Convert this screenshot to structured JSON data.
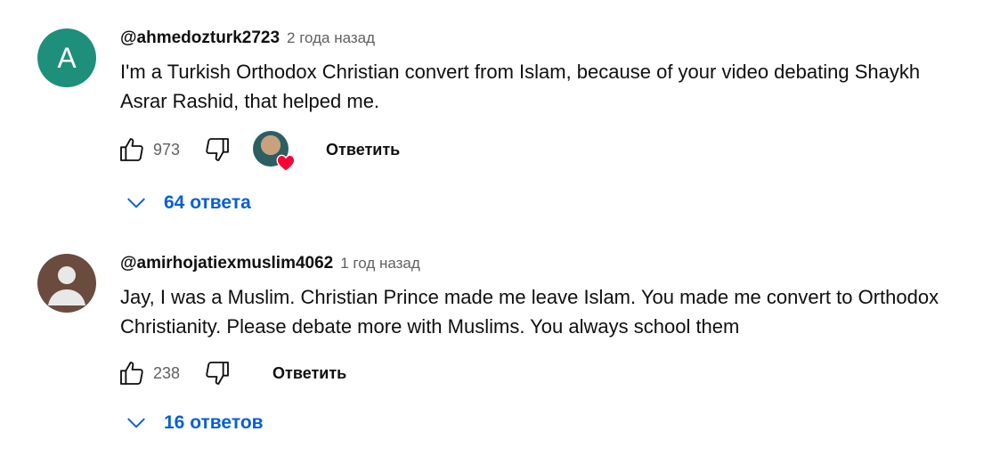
{
  "comments": [
    {
      "avatar_letter": "A",
      "author": "@ahmedozturk2723",
      "time": "2 года назад",
      "text_line1": "I'm a Turkish Orthodox Christian convert from Islam, because of your video debating Shaykh",
      "text_line2": "Asrar Rashid, that helped me.",
      "likes": "973",
      "reply_label": "Ответить",
      "replies_label": "64 ответа",
      "creator_heart": true
    },
    {
      "avatar_letter": "",
      "author": "@amirhojatiexmuslim4062",
      "time": "1 год назад",
      "text_line1": "Jay, I was a Muslim. Christian Prince made me leave Islam. You made me convert to Orthodox",
      "text_line2": "Christianity. Please debate more with Muslims. You always school them",
      "likes": "238",
      "reply_label": "Ответить",
      "replies_label": "16 ответов",
      "creator_heart": false
    }
  ],
  "icons": {
    "like": "thumb-up-icon",
    "dislike": "thumb-down-icon",
    "expand": "chevron-down-icon",
    "heart": "heart-icon"
  },
  "colors": {
    "link_blue": "#065fd4",
    "avatar_teal": "#1e8f7a",
    "avatar_brown": "#6a4b3e",
    "heart_red": "#ff0033"
  }
}
